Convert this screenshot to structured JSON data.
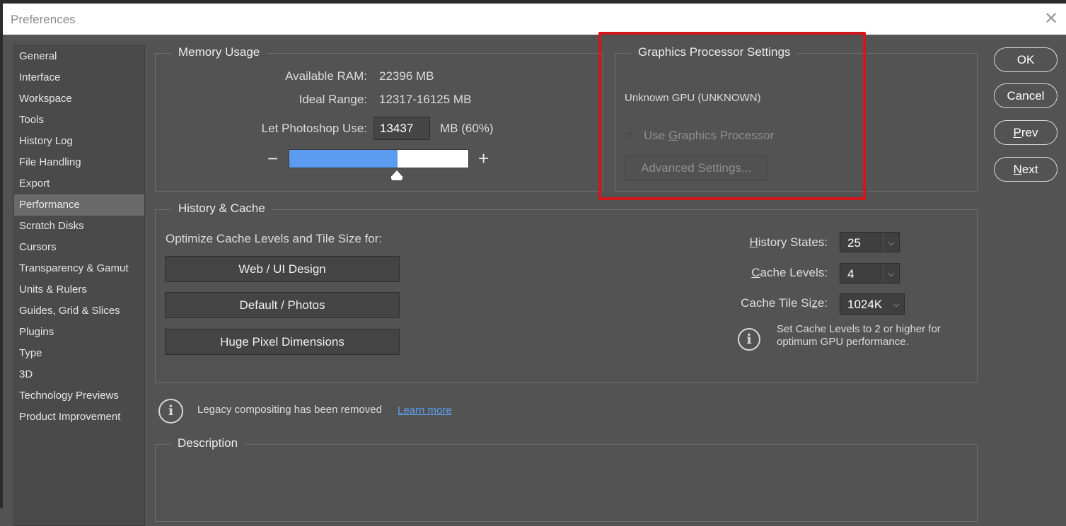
{
  "window": {
    "title": "Preferences"
  },
  "sidebar": {
    "items": [
      {
        "label": "General"
      },
      {
        "label": "Interface"
      },
      {
        "label": "Workspace"
      },
      {
        "label": "Tools"
      },
      {
        "label": "History Log"
      },
      {
        "label": "File Handling"
      },
      {
        "label": "Export"
      },
      {
        "label": "Performance"
      },
      {
        "label": "Scratch Disks"
      },
      {
        "label": "Cursors"
      },
      {
        "label": "Transparency & Gamut"
      },
      {
        "label": "Units & Rulers"
      },
      {
        "label": "Guides, Grid & Slices"
      },
      {
        "label": "Plugins"
      },
      {
        "label": "Type"
      },
      {
        "label": "3D"
      },
      {
        "label": "Technology Previews"
      },
      {
        "label": "Product Improvement"
      }
    ],
    "active": "Performance"
  },
  "memory": {
    "legend": "Memory Usage",
    "available_label": "Available RAM:",
    "available_value": "22396 MB",
    "ideal_label": "Ideal Range:",
    "ideal_value": "12317-16125 MB",
    "use_label": "Let Photoshop Use:",
    "use_value": "13437",
    "use_suffix": "MB (60%)",
    "slider_percent": 60,
    "minus": "−",
    "plus": "+"
  },
  "gpu": {
    "legend": "Graphics Processor Settings",
    "gpu_name": "Unknown GPU (UNKNOWN)",
    "use_gpu_pre": "Use ",
    "use_gpu_mnemonic": "G",
    "use_gpu_post": "raphics Processor",
    "advanced_label": "Advanced Settings..."
  },
  "cache": {
    "legend": "History & Cache",
    "optimize_label": "Optimize Cache Levels and Tile Size for:",
    "presets": [
      "Web / UI Design",
      "Default / Photos",
      "Huge Pixel Dimensions"
    ],
    "history_states_label": "istory States:",
    "history_states_mnemonic": "H",
    "history_states_value": "25",
    "cache_levels_label": "ache Levels:",
    "cache_levels_mnemonic": "C",
    "cache_levels_value": "4",
    "tile_size_label_pre": "Cache Tile Si",
    "tile_size_mnemonic": "z",
    "tile_size_label_post": "e:",
    "tile_size_value": "1024K",
    "gpu_tip": "Set Cache Levels to 2 or higher for\noptimum GPU performance."
  },
  "legacy": {
    "message": "Legacy compositing has been removed",
    "link": "Learn more"
  },
  "description": {
    "legend": "Description"
  },
  "buttons": {
    "ok": "OK",
    "cancel": "Cancel",
    "prev_mnemonic": "P",
    "prev_rest": "rev",
    "next_mnemonic": "N",
    "next_rest": "ext"
  },
  "colors": {
    "background": "#535353",
    "accent_slider": "#5b9cf0",
    "highlight_box": "#d4161b",
    "link": "#5aa0ef"
  }
}
